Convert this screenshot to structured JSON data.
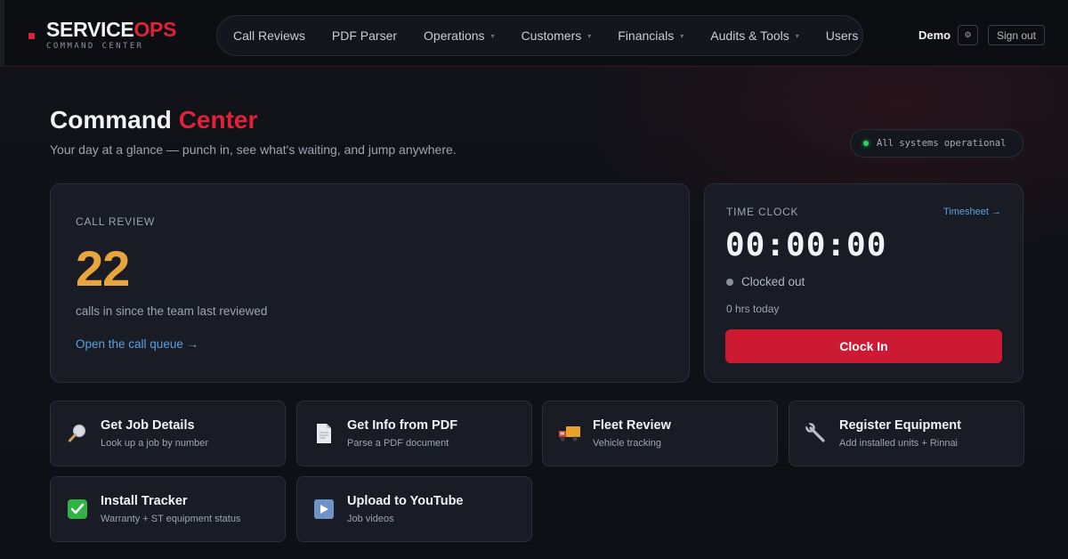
{
  "brand": {
    "name_part1": "SERVICE",
    "name_part2": "OPS",
    "subtitle": "COMMAND CENTER"
  },
  "nav": {
    "items": [
      {
        "label": "Call Reviews",
        "has_dropdown": false
      },
      {
        "label": "PDF Parser",
        "has_dropdown": false
      },
      {
        "label": "Operations",
        "has_dropdown": true
      },
      {
        "label": "Customers",
        "has_dropdown": true
      },
      {
        "label": "Financials",
        "has_dropdown": true
      },
      {
        "label": "Audits & Tools",
        "has_dropdown": true
      },
      {
        "label": "Users",
        "has_dropdown": false
      }
    ],
    "caret": "▾"
  },
  "user": {
    "name": "Demo",
    "settings_icon": "gear-icon",
    "settings_glyph": "⚙",
    "signout_label": "Sign out"
  },
  "hero": {
    "title_part1": "Command ",
    "title_part2": "Center",
    "subtitle": "Your day at a glance — punch in, see what's waiting, and jump anywhere.",
    "system_status": "All systems operational"
  },
  "call_review": {
    "label": "CALL REVIEW",
    "count": "22",
    "description": "calls in since the team last reviewed",
    "link": "Open the call queue →"
  },
  "time_clock": {
    "label": "TIME CLOCK",
    "timesheet_link": "Timesheet →",
    "time": "00:00:00",
    "status": "Clocked out",
    "hours_today": "0 hrs today",
    "button": "Clock In"
  },
  "tiles": [
    {
      "title": "Get Job Details",
      "subtitle": "Look up a job by number",
      "icon": "magnifier-icon",
      "glyph": "🔎"
    },
    {
      "title": "Get Info from PDF",
      "subtitle": "Parse a PDF document",
      "icon": "document-icon",
      "glyph": "📄"
    },
    {
      "title": "Fleet Review",
      "subtitle": "Vehicle tracking",
      "icon": "truck-icon",
      "glyph": "🚚"
    },
    {
      "title": "Register Equipment",
      "subtitle": "Add installed units + Rinnai",
      "icon": "wrench-icon",
      "glyph": "🔧"
    },
    {
      "title": "Install Tracker",
      "subtitle": "Warranty + ST equipment status",
      "icon": "checkmark-icon",
      "glyph": "✔"
    },
    {
      "title": "Upload to YouTube",
      "subtitle": "Job videos",
      "icon": "play-icon",
      "glyph": "▶"
    }
  ],
  "colors": {
    "accent_red": "#e3203a",
    "button_red": "#cb1a32",
    "count_amber": "#e9a53d",
    "link_blue": "#5a9fe0",
    "status_green": "#2bd46a"
  }
}
